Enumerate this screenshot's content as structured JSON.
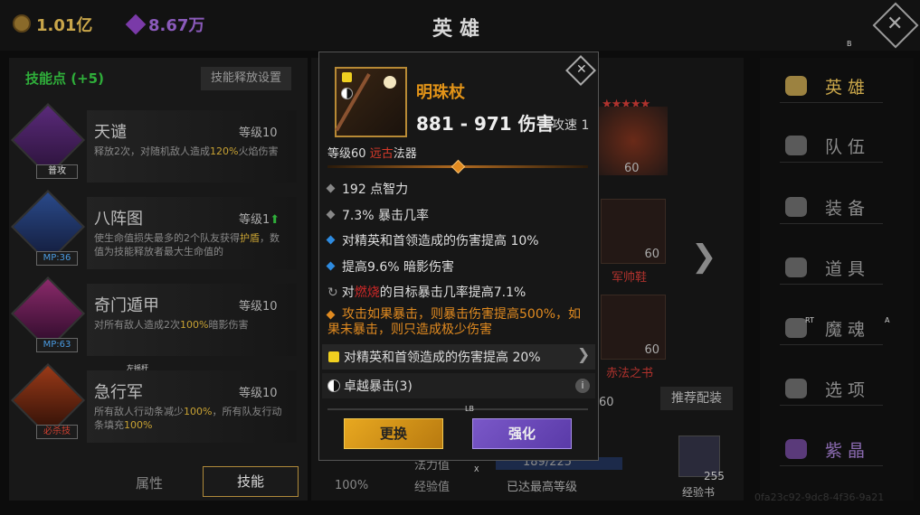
{
  "currency": {
    "gold": "1.01亿",
    "gems": "8.67万"
  },
  "header": {
    "title": "英雄"
  },
  "controller_hints": {
    "b": "B",
    "lt": "LT",
    "rt": "RT",
    "a": "A",
    "lb": "LB",
    "x": "X",
    "ls": "左摇杆"
  },
  "skills_panel": {
    "points_label": "技能点 (+5)",
    "settings_label": "技能释放设置",
    "skills": [
      {
        "name": "天谴",
        "level": "等级10",
        "tag": "普攻",
        "desc_pre": "释放2次，对随机敌人造成",
        "desc_hl": "120%",
        "desc_post": "火焰伤害"
      },
      {
        "name": "八阵图",
        "level": "等级1",
        "tag": "MP:36",
        "desc_pre": "使生命值损失最多的2个队友获得",
        "desc_hl": "护盾",
        "desc_post": "，数值为技能释放者最大生命值的"
      },
      {
        "name": "奇门遁甲",
        "level": "等级10",
        "tag": "MP:63",
        "desc_pre": "对所有敌人造成2次",
        "desc_hl": "100%",
        "desc_post": "暗影伤害"
      },
      {
        "name": "急行军",
        "level": "等级10",
        "tag": "必杀技",
        "desc_pre": "所有敌人行动条减少",
        "desc_hl": "100%",
        "desc_post": "，所有队友行动条填充",
        "desc_hl2": "100%"
      }
    ],
    "tabs": {
      "attr": "属性",
      "skill": "技能"
    }
  },
  "hero_view": {
    "level_num": "60",
    "slots": [
      {
        "name": "军帅鞋",
        "level": "60"
      },
      {
        "name": "赤法之书",
        "level": "60"
      }
    ],
    "partial_num": "60",
    "recommend": "推荐配装",
    "exp_book": {
      "label": "经验书",
      "count": "255"
    },
    "bottom": {
      "row1": "法力值",
      "mp": "189/225",
      "row2": "经验值",
      "max": "已达最高等级",
      "pct": "100%"
    }
  },
  "nav": [
    {
      "label": "英雄",
      "active": true
    },
    {
      "label": "队伍"
    },
    {
      "label": "装备"
    },
    {
      "label": "道具"
    },
    {
      "label": "魔魂"
    },
    {
      "label": "选项"
    },
    {
      "label": "紫晶"
    }
  ],
  "watermark": "0fa23c92-9dc8-4f36-9a21",
  "item": {
    "name": "明珠杖",
    "damage": "881 - 971 伤害",
    "speed": "攻速 1",
    "level_prefix": "等级60 ",
    "level_red": "远古",
    "level_suffix": "法器",
    "stats": [
      {
        "icon": "g",
        "text": "192 点智力"
      },
      {
        "icon": "g",
        "text": "7.3% 暴击几率"
      },
      {
        "icon": "b",
        "text": "对精英和首领造成的伤害提高 10%"
      },
      {
        "icon": "b",
        "text": "提高9.6% 暗影伤害"
      }
    ],
    "burn_pre": "对",
    "burn_red": "燃烧",
    "burn_post": "的目标暴击几率提高7.1%",
    "crit_effect": "攻击如果暴击，则暴击伤害提高500%，如果未暴击，则只造成极少伤害",
    "perk1": "对精英和首领造成的伤害提高 20%",
    "perk2": "卓越暴击(3)",
    "btn_swap": "更换",
    "btn_upgrade": "强化"
  },
  "colors": {
    "accent_gold": "#c9a64a",
    "orange": "#e08a20",
    "red": "#d02828",
    "blue": "#2e8be0",
    "purple": "#6a4ab8"
  }
}
